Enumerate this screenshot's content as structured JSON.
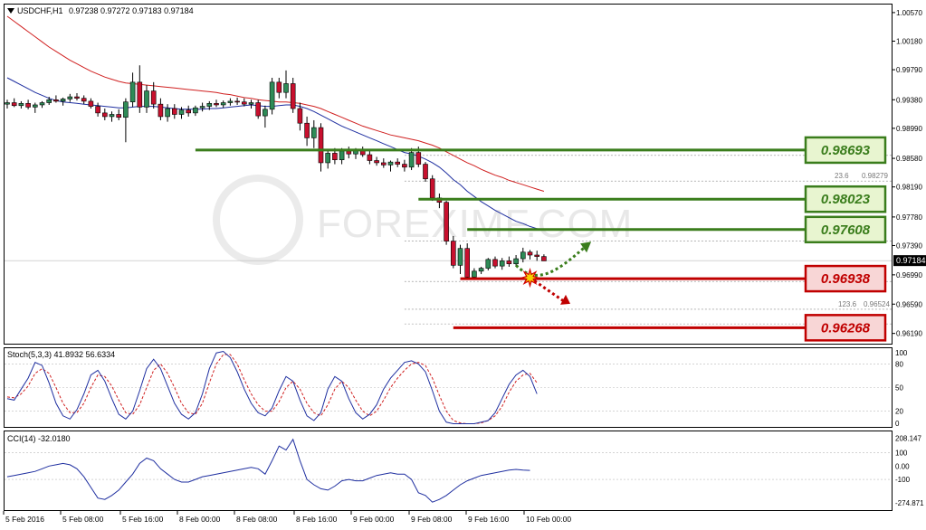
{
  "header": {
    "symbol": "USDCHF,H1",
    "ohlc": "0.97238 0.97272 0.97183 0.97184",
    "price_label": "0.97184"
  },
  "watermark": "FOREXIMF.COM",
  "colors": {
    "bull": "#2e8b57",
    "bear": "#c8102e",
    "ma_fast": "#1f2fa0",
    "ma_slow": "#d02020",
    "support": "#c00000",
    "resistance": "#3a7d1c",
    "osc": "#1f2fa0",
    "signal": "#d02020",
    "label_green_bg": "#e8f5d0",
    "label_red_bg": "#f8d6d6"
  },
  "icons": {
    "dropdown": "dropdown-triangle-icon",
    "breakout": "breakout-burst-icon"
  },
  "chart_data": {
    "type": "candlestick",
    "price_axis": {
      "ylim": [
        0.9605,
        1.0068
      ],
      "ticks": [
        "1.00570",
        "1.00180",
        "0.99790",
        "0.99380",
        "0.98990",
        "0.98580",
        "0.98190",
        "0.97780",
        "0.97390",
        "0.96990",
        "0.96590",
        "0.96190"
      ]
    },
    "time_axis": {
      "labels": [
        "5 Feb 2016",
        "5 Feb 08:00",
        "5 Feb 16:00",
        "8 Feb 00:00",
        "8 Feb 08:00",
        "8 Feb 16:00",
        "9 Feb 00:00",
        "9 Feb 08:00",
        "9 Feb 16:00",
        "10 Feb 00:00"
      ]
    },
    "candles": [
      [
        0.9932,
        0.9938,
        0.9926,
        0.9934
      ],
      [
        0.9934,
        0.994,
        0.9928,
        0.993
      ],
      [
        0.993,
        0.9936,
        0.9926,
        0.9933
      ],
      [
        0.9933,
        0.9938,
        0.9925,
        0.9928
      ],
      [
        0.9928,
        0.9934,
        0.992,
        0.9931
      ],
      [
        0.9931,
        0.9936,
        0.9927,
        0.9934
      ],
      [
        0.9934,
        0.9942,
        0.9931,
        0.9938
      ],
      [
        0.9938,
        0.9944,
        0.9934,
        0.9936
      ],
      [
        0.9936,
        0.9941,
        0.993,
        0.9939
      ],
      [
        0.9939,
        0.9946,
        0.9935,
        0.9942
      ],
      [
        0.9942,
        0.9947,
        0.9937,
        0.994
      ],
      [
        0.994,
        0.9944,
        0.9932,
        0.9936
      ],
      [
        0.9936,
        0.994,
        0.9926,
        0.9929
      ],
      [
        0.9929,
        0.9934,
        0.9915,
        0.992
      ],
      [
        0.992,
        0.9926,
        0.991,
        0.9915
      ],
      [
        0.9915,
        0.9922,
        0.9908,
        0.9918
      ],
      [
        0.9918,
        0.9925,
        0.991,
        0.9914
      ],
      [
        0.9914,
        0.994,
        0.988,
        0.9935
      ],
      [
        0.9935,
        0.9975,
        0.9928,
        0.9962
      ],
      [
        0.9962,
        0.9985,
        0.992,
        0.9928
      ],
      [
        0.9928,
        0.9958,
        0.992,
        0.995
      ],
      [
        0.995,
        0.9962,
        0.9926,
        0.9932
      ],
      [
        0.9932,
        0.994,
        0.991,
        0.9915
      ],
      [
        0.9915,
        0.9932,
        0.9908,
        0.9926
      ],
      [
        0.9926,
        0.9932,
        0.9912,
        0.9918
      ],
      [
        0.9918,
        0.9928,
        0.9912,
        0.9924
      ],
      [
        0.9924,
        0.993,
        0.9915,
        0.992
      ],
      [
        0.992,
        0.993,
        0.9916,
        0.9927
      ],
      [
        0.9927,
        0.9934,
        0.9922,
        0.9929
      ],
      [
        0.9929,
        0.9936,
        0.9924,
        0.9933
      ],
      [
        0.9933,
        0.9938,
        0.9928,
        0.9931
      ],
      [
        0.9931,
        0.9937,
        0.9927,
        0.9934
      ],
      [
        0.9934,
        0.994,
        0.993,
        0.9936
      ],
      [
        0.9936,
        0.9941,
        0.9931,
        0.9935
      ],
      [
        0.9935,
        0.994,
        0.9929,
        0.9932
      ],
      [
        0.9932,
        0.9938,
        0.9926,
        0.9934
      ],
      [
        0.9934,
        0.9938,
        0.9912,
        0.9916
      ],
      [
        0.9916,
        0.993,
        0.99,
        0.9925
      ],
      [
        0.9925,
        0.9968,
        0.9918,
        0.9962
      ],
      [
        0.9962,
        0.9968,
        0.994,
        0.9948
      ],
      [
        0.9948,
        0.9978,
        0.994,
        0.996
      ],
      [
        0.996,
        0.9968,
        0.992,
        0.9926
      ],
      [
        0.9926,
        0.9934,
        0.9896,
        0.9906
      ],
      [
        0.9906,
        0.9915,
        0.9875,
        0.9886
      ],
      [
        0.9886,
        0.991,
        0.9872,
        0.99
      ],
      [
        0.99,
        0.9906,
        0.984,
        0.9852
      ],
      [
        0.9852,
        0.987,
        0.9844,
        0.9865
      ],
      [
        0.9865,
        0.9872,
        0.985,
        0.9856
      ],
      [
        0.9856,
        0.9872,
        0.985,
        0.9868
      ],
      [
        0.9868,
        0.9874,
        0.9858,
        0.9864
      ],
      [
        0.9864,
        0.9872,
        0.9857,
        0.9869
      ],
      [
        0.9869,
        0.9874,
        0.986,
        0.9863
      ],
      [
        0.9863,
        0.9868,
        0.985,
        0.9855
      ],
      [
        0.9855,
        0.986,
        0.9848,
        0.9852
      ],
      [
        0.9852,
        0.9858,
        0.9845,
        0.9849
      ],
      [
        0.9849,
        0.9855,
        0.984,
        0.9853
      ],
      [
        0.9853,
        0.9858,
        0.9846,
        0.985
      ],
      [
        0.985,
        0.9856,
        0.984,
        0.9846
      ],
      [
        0.9846,
        0.9872,
        0.9842,
        0.9866
      ],
      [
        0.9866,
        0.9874,
        0.9846,
        0.985
      ],
      [
        0.985,
        0.9853,
        0.9826,
        0.983
      ],
      [
        0.983,
        0.9835,
        0.98,
        0.9804
      ],
      [
        0.9804,
        0.981,
        0.979,
        0.9798
      ],
      [
        0.9798,
        0.98,
        0.974,
        0.9745
      ],
      [
        0.9745,
        0.9752,
        0.9708,
        0.9712
      ],
      [
        0.9712,
        0.974,
        0.97,
        0.9735
      ],
      [
        0.9735,
        0.9742,
        0.9692,
        0.9696
      ],
      [
        0.9696,
        0.9708,
        0.9692,
        0.9704
      ],
      [
        0.9704,
        0.971,
        0.97,
        0.9708
      ],
      [
        0.9708,
        0.9722,
        0.9705,
        0.972
      ],
      [
        0.972,
        0.9724,
        0.9708,
        0.9711
      ],
      [
        0.9711,
        0.9722,
        0.9706,
        0.9718
      ],
      [
        0.9718,
        0.9724,
        0.971,
        0.9714
      ],
      [
        0.9714,
        0.9726,
        0.971,
        0.9721
      ],
      [
        0.9721,
        0.9736,
        0.9716,
        0.973
      ],
      [
        0.973,
        0.9733,
        0.972,
        0.9726
      ],
      [
        0.9726,
        0.9732,
        0.9718,
        0.9724
      ],
      [
        0.9724,
        0.9727,
        0.9718,
        0.9718
      ]
    ],
    "ma_fast_series": [
      0.9968,
      0.9963,
      0.9958,
      0.9953,
      0.9948,
      0.9944,
      0.994,
      0.9937,
      0.9935,
      0.9934,
      0.9933,
      0.9932,
      0.9931,
      0.993,
      0.9929,
      0.9928,
      0.9927,
      0.9927,
      0.9928,
      0.9929,
      0.9929,
      0.9929,
      0.9928,
      0.9927,
      0.9926,
      0.9925,
      0.9925,
      0.9925,
      0.9925,
      0.9926,
      0.9926,
      0.9927,
      0.9928,
      0.9929,
      0.993,
      0.9931,
      0.993,
      0.9929,
      0.9929,
      0.993,
      0.9931,
      0.9931,
      0.9929,
      0.9926,
      0.9922,
      0.9917,
      0.9912,
      0.9907,
      0.9902,
      0.9898,
      0.9894,
      0.989,
      0.9886,
      0.9882,
      0.9878,
      0.9874,
      0.987,
      0.9866,
      0.9864,
      0.9861,
      0.9857,
      0.9852,
      0.9846,
      0.9838,
      0.9829,
      0.9822,
      0.9813,
      0.9806,
      0.9799,
      0.9793,
      0.9787,
      0.9782,
      0.9777,
      0.9772,
      0.9769,
      0.9765,
      0.9762,
      0.976
    ],
    "ma_slow_series": [
      1.0052,
      1.0045,
      1.0038,
      1.0031,
      1.0024,
      1.0017,
      1.001,
      1.0004,
      0.9998,
      0.9992,
      0.9987,
      0.9982,
      0.9977,
      0.9973,
      0.9969,
      0.9966,
      0.9963,
      0.9961,
      0.996,
      0.9959,
      0.9958,
      0.9957,
      0.9956,
      0.9955,
      0.9954,
      0.9953,
      0.9952,
      0.9951,
      0.995,
      0.9949,
      0.9948,
      0.9946,
      0.9945,
      0.9943,
      0.9941,
      0.994,
      0.9938,
      0.9937,
      0.9936,
      0.9935,
      0.9935,
      0.9934,
      0.9933,
      0.9931,
      0.9929,
      0.9926,
      0.9922,
      0.9918,
      0.9914,
      0.991,
      0.9906,
      0.9902,
      0.9899,
      0.9896,
      0.9893,
      0.989,
      0.9888,
      0.9886,
      0.9884,
      0.9882,
      0.9879,
      0.9876,
      0.9872,
      0.9867,
      0.9862,
      0.9857,
      0.9852,
      0.9848,
      0.9843,
      0.9839,
      0.9835,
      0.9832,
      0.9828,
      0.9825,
      0.9822,
      0.9819,
      0.9816,
      0.9813
    ],
    "levels": [
      {
        "label": "0.98693",
        "value": 0.98693,
        "kind": "resistance",
        "start": 27
      },
      {
        "label": "0.98023",
        "value": 0.98023,
        "kind": "resistance",
        "start": 59
      },
      {
        "label": "0.97608",
        "value": 0.97608,
        "kind": "resistance",
        "start": 66
      },
      {
        "label": "0.96938",
        "value": 0.96938,
        "kind": "support",
        "start": 65
      },
      {
        "label": "0.96268",
        "value": 0.96268,
        "kind": "support",
        "start": 64
      }
    ],
    "fib_lines": [
      {
        "value": 0.9862,
        "start": 57
      },
      {
        "value": 0.9827,
        "start": 57
      },
      {
        "value": 0.9745,
        "start": 57
      },
      {
        "value": 0.969,
        "start": 57
      },
      {
        "value": 0.9652,
        "start": 57
      },
      {
        "value": 0.9632,
        "start": 57
      }
    ],
    "fib_labels": [
      {
        "text": "23.6",
        "value": 0.9827
      },
      {
        "text": "0.98279",
        "value": 0.9827
      },
      {
        "text": "123.6",
        "value": 0.9652
      },
      {
        "text": "0.96524",
        "value": 0.9652
      }
    ],
    "current_price": 0.97184,
    "projection": {
      "bullish": [
        [
          73,
          0.9712
        ],
        [
          76,
          0.9698
        ],
        [
          79,
          0.9704
        ],
        [
          83,
          0.9738
        ]
      ],
      "bearish": [
        [
          75,
          0.9695
        ],
        [
          80,
          0.9662
        ]
      ]
    },
    "stoch": {
      "label": "Stoch(5,3,3) 41.8932 56.6334",
      "ylim": [
        0,
        100
      ],
      "ticks": [
        "100",
        "80",
        "50",
        "20",
        "0"
      ],
      "k": [
        36,
        34,
        48,
        62,
        82,
        78,
        56,
        30,
        14,
        10,
        22,
        42,
        66,
        72,
        58,
        36,
        16,
        10,
        20,
        46,
        74,
        86,
        74,
        52,
        30,
        16,
        10,
        18,
        42,
        74,
        94,
        96,
        88,
        70,
        48,
        30,
        18,
        14,
        24,
        46,
        64,
        58,
        34,
        14,
        8,
        18,
        48,
        64,
        58,
        36,
        18,
        10,
        16,
        28,
        48,
        62,
        72,
        82,
        84,
        80,
        70,
        46,
        20,
        6,
        4,
        4,
        4,
        4,
        6,
        8,
        18,
        36,
        54,
        66,
        72,
        64,
        42
      ],
      "d": [
        38,
        37,
        42,
        52,
        68,
        74,
        68,
        50,
        30,
        18,
        18,
        30,
        50,
        66,
        64,
        52,
        34,
        18,
        16,
        28,
        50,
        72,
        80,
        68,
        50,
        30,
        18,
        16,
        30,
        56,
        80,
        92,
        92,
        80,
        60,
        42,
        28,
        20,
        20,
        32,
        50,
        58,
        48,
        30,
        18,
        14,
        28,
        48,
        58,
        50,
        34,
        20,
        14,
        20,
        34,
        50,
        62,
        72,
        80,
        82,
        78,
        62,
        40,
        20,
        8,
        5,
        4,
        4,
        5,
        8,
        14,
        26,
        44,
        58,
        66,
        68,
        56
      ]
    },
    "cci": {
      "label": "CCI(14) -32.0180",
      "ylim": [
        -330,
        260
      ],
      "ticks": [
        "208.147",
        "100",
        "0.00",
        "-100",
        "-274.871"
      ],
      "values": [
        -80,
        -70,
        -60,
        -50,
        -40,
        -20,
        0,
        10,
        20,
        10,
        -20,
        -80,
        -160,
        -240,
        -250,
        -220,
        -180,
        -120,
        -60,
        20,
        60,
        40,
        -20,
        -60,
        -100,
        -120,
        -120,
        -100,
        -80,
        -70,
        -60,
        -50,
        -40,
        -30,
        -20,
        -10,
        -20,
        -60,
        40,
        150,
        120,
        200,
        40,
        -100,
        -140,
        -170,
        -180,
        -150,
        -110,
        -100,
        -110,
        -110,
        -90,
        -70,
        -60,
        -50,
        -60,
        -60,
        -100,
        -200,
        -220,
        -270,
        -250,
        -220,
        -180,
        -140,
        -110,
        -90,
        -70,
        -60,
        -50,
        -40,
        -30,
        -25,
        -30,
        -32
      ]
    }
  }
}
